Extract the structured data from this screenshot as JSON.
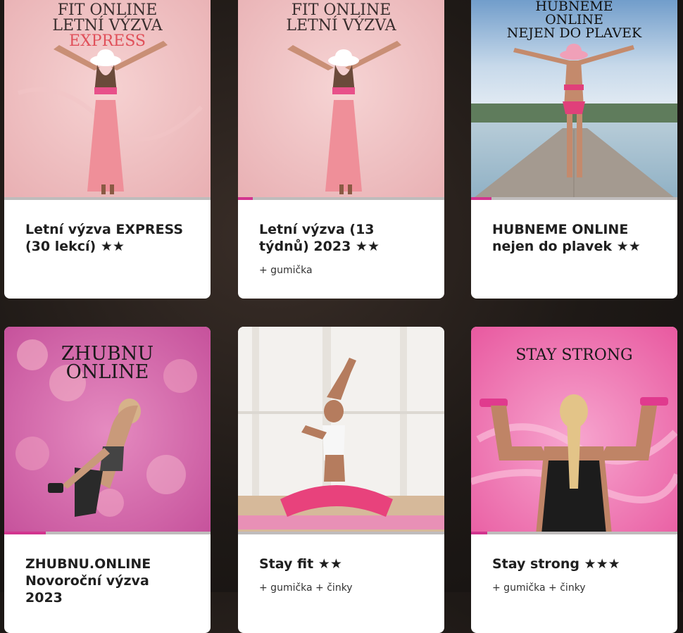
{
  "cards": [
    {
      "title": "Letní výzva EXPRESS (30 lekcí) ★★",
      "subtitle": "",
      "poster": [
        "FIT ONLINE",
        "LETNÍ VÝZVA",
        "EXPRESS"
      ],
      "progress": 0.0
    },
    {
      "title": "Letní výzva (13 týdnů) 2023 ★★",
      "subtitle": "+ gumička",
      "poster": [
        "FIT ONLINE",
        "LETNÍ VÝZVA"
      ],
      "progress": 0.07
    },
    {
      "title": "HUBNEME ONLINE nejen do plavek ★★",
      "subtitle": "",
      "poster": [
        "HUBNEME",
        "ONLINE",
        "NEJEN DO PLAVEK"
      ],
      "progress": 0.1
    },
    {
      "title": "ZHUBNU.ONLINE Novoroční výzva 2023",
      "subtitle": "",
      "poster": [
        "ZHUBNU",
        "ONLINE"
      ],
      "progress": 0.2
    },
    {
      "title": "Stay fit ★★",
      "subtitle": "+ gumička + činky",
      "poster": [],
      "progress": 0.0
    },
    {
      "title": "Stay strong ★★★",
      "subtitle": "+ gumička + činky",
      "poster": [
        "STAY STRONG"
      ],
      "progress": 0.08
    }
  ],
  "colors": {
    "accent": "#d2358f",
    "progress_track": "#bfbcbc",
    "title": "#1f1f1f"
  }
}
